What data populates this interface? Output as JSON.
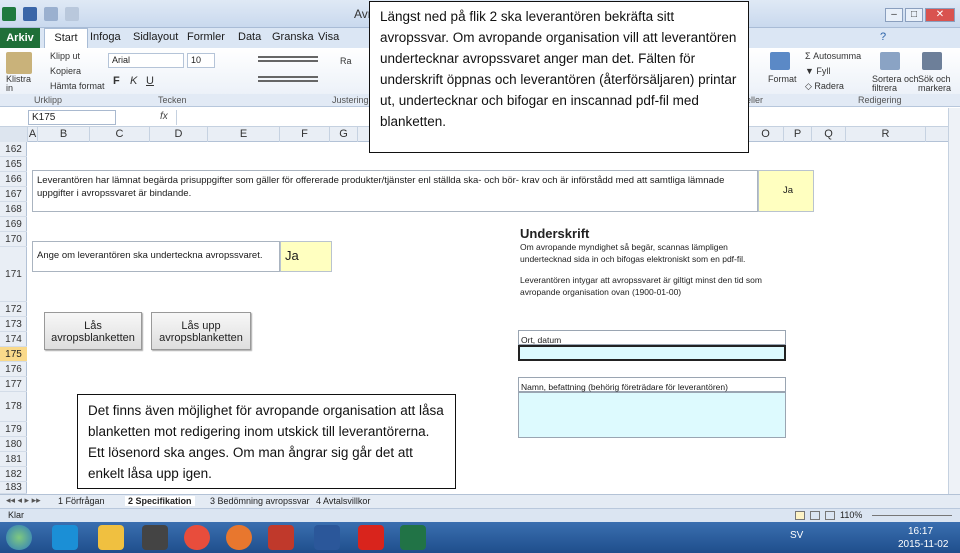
{
  "window": {
    "title": "Avro",
    "controls": [
      "–",
      "□",
      "✕"
    ]
  },
  "ribbon_tabs": [
    "Arkiv",
    "Start",
    "Infoga",
    "Sidlayout",
    "Formler",
    "Data",
    "Granska",
    "Visa"
  ],
  "ribbon": {
    "paste_label": "Klistra\nin",
    "cut_label": "Klipp ut",
    "copy_label": "Kopiera",
    "format_painter_label": "Hämta format",
    "font_name": "Arial",
    "font_size": "10",
    "wrap_label": "Ra",
    "format_label": "Format",
    "autosum_label": "Autosumma",
    "fill_label": "Fyll",
    "clear_label": "Radera",
    "sort_label": "Sortera och\nfiltrera",
    "find_label": "Sök och\nmarkera",
    "groups": [
      "Urklipp",
      "Tecken",
      "Justering",
      "eller",
      "Redigering"
    ]
  },
  "formula_bar": {
    "name_box": "K175",
    "fx": "fx",
    "value": ""
  },
  "columns": [
    "A",
    "B",
    "C",
    "D",
    "E",
    "F",
    "G",
    "O",
    "P",
    "Q",
    "R"
  ],
  "rows": [
    "162",
    "165",
    "166",
    "167",
    "168",
    "169",
    "170",
    "171",
    "172",
    "173",
    "174",
    "175",
    "176",
    "177",
    "178",
    "179",
    "180",
    "181",
    "182",
    "183"
  ],
  "sheet": {
    "statement": "Leverantören har lämnat begärda prisuppgifter som gäller för offererade produkter/tjänster enl ställda ska- och bör- krav och är införstådd med att samtliga lämnade uppgifter i avropssvaret är bindande.",
    "statement_answer": "Ja",
    "sign_question": "Ange om leverantören ska underteckna avropssvaret.",
    "sign_answer": "Ja",
    "lock_button": "Lås\navropsblanketten",
    "unlock_button": "Lås upp\navropsblanketten",
    "signature_title": "Underskrift",
    "signature_text1": "Om avropande myndighet så begär, scannas lämpligen undertecknad sida in och bifogas elektroniskt som en pdf-fil.",
    "signature_text2": "Leverantören intygar att avropssvaret är giltigt minst den tid som avropande organisation ovan (1900-01-00)",
    "place_date_label": "Ort, datum",
    "name_label": "Namn, befattning (behörig företrädare för leverantören)"
  },
  "sheet_tabs": [
    "1 Förfrågan",
    "2 Specifikation",
    "3 Bedömning avropssvar",
    "4 Avtalsvillkor"
  ],
  "status": {
    "left": "Klar",
    "zoom": "110%"
  },
  "taskbar": {
    "lang": "SV",
    "time": "16:17",
    "date": "2015-11-02"
  },
  "callouts": {
    "top": "Längst ned på flik 2 ska leverantören bekräfta sitt avropssvar. Om avropande organisation vill att leverantören undertecknar avropssvaret anger man det. Fälten för underskrift öppnas och leverantören (återförsäljaren) printar ut, undertecknar och bifogar en inscannad pdf-fil med blanketten.",
    "bottom": "Det finns även möjlighet för avropande organisation att låsa blanketten mot redigering inom utskick till leverantörerna. Ett lösenord ska anges. Om man ångrar sig går det att enkelt låsa upp igen."
  },
  "colors": {
    "excel_green": "#1f6f38",
    "input_yellow": "#ffffc0",
    "input_cyan": "#ddfafe",
    "selected_row": "#f9d98a"
  }
}
